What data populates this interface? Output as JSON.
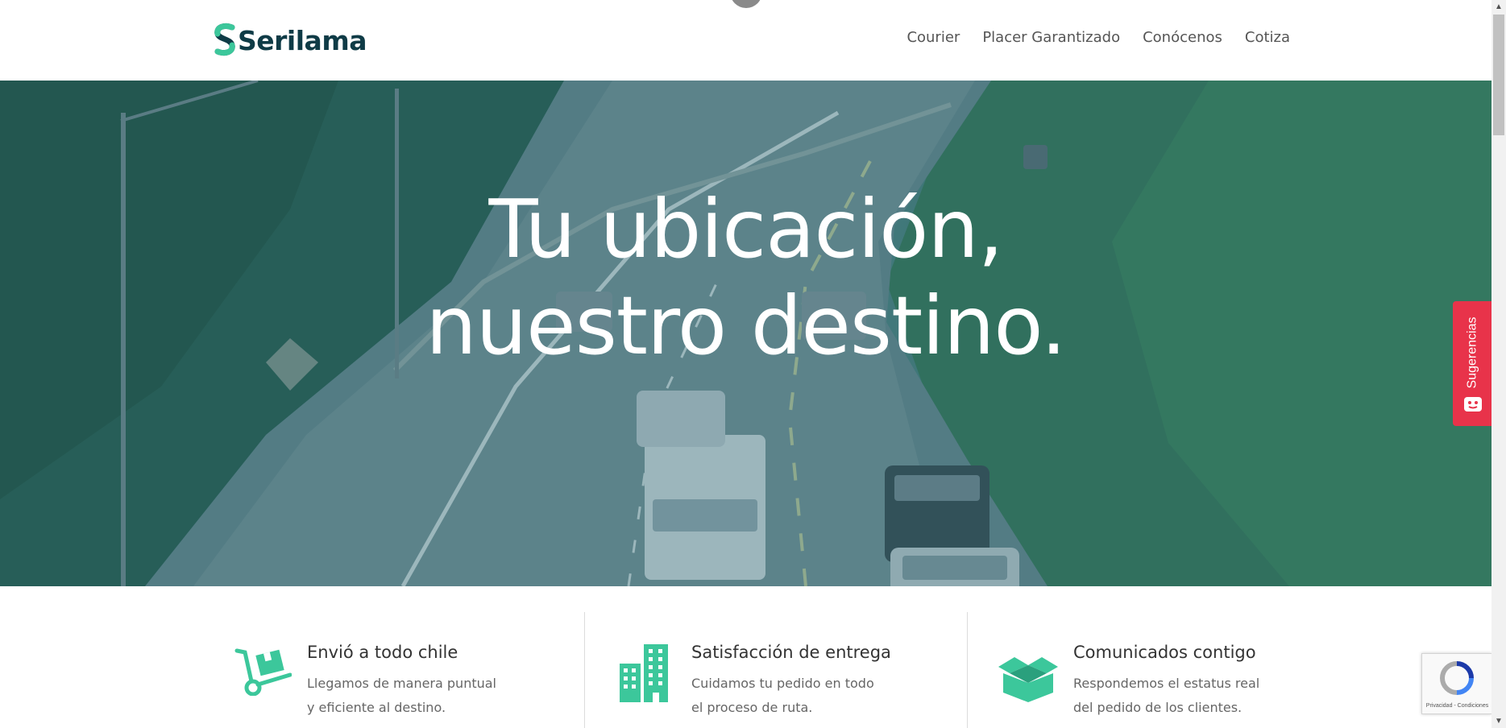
{
  "header": {
    "logo_text": "Serilama",
    "nav": [
      "Courier",
      "Placer Garantizado",
      "Conócenos",
      "Cotiza"
    ]
  },
  "hero": {
    "title_line1": "Tu ubicación,",
    "title_line2": "nuestro destino."
  },
  "feedback_tab": {
    "label": "Sugerencias"
  },
  "features": [
    {
      "icon": "hand-truck-icon",
      "title": "Envió a todo chile",
      "line1": "Llegamos de manera puntual",
      "line2": "y eficiente al destino."
    },
    {
      "icon": "building-icon",
      "title": "Satisfacción de entrega",
      "line1": "Cuidamos tu pedido en todo",
      "line2": "el proceso de ruta."
    },
    {
      "icon": "open-box-icon",
      "title": "Comunicados contigo",
      "line1": "Respondemos el estatus real",
      "line2": "del pedido de los clientes."
    }
  ],
  "recaptcha": {
    "footer": "Privacidad - Condiciones"
  },
  "colors": {
    "brand_teal": "#3cc79b",
    "brand_dark": "#0f3b46",
    "feedback_red": "#e8334a"
  }
}
